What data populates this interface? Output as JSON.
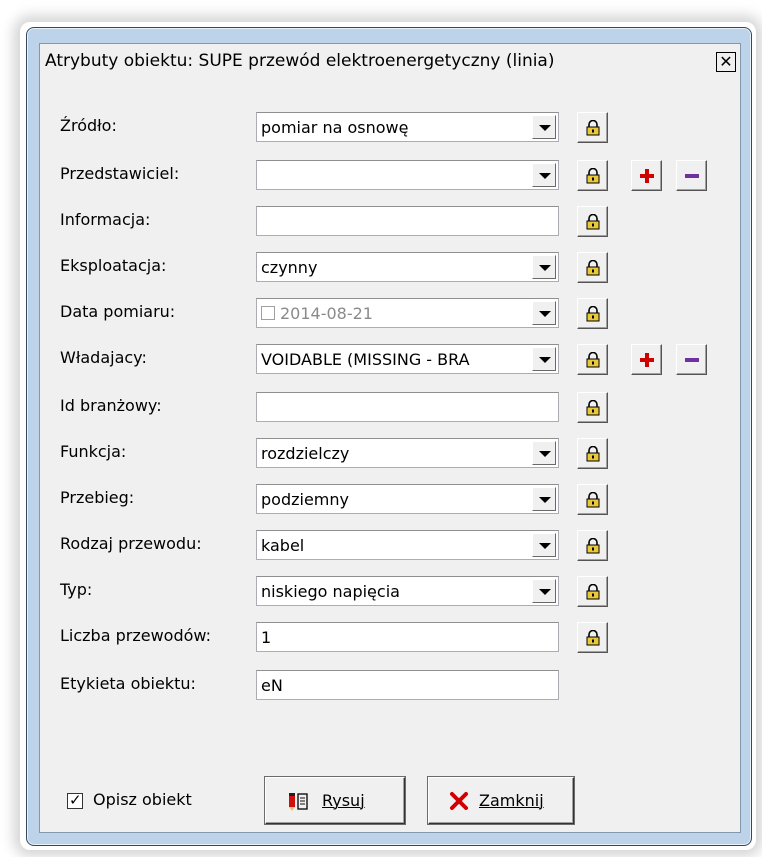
{
  "window": {
    "title": "Atrybuty obiektu: SUPE przewód elektroenergetyczny (linia)"
  },
  "fields": [
    {
      "label": "Źródło:",
      "value": "pomiar na osnowę",
      "kind": "combo",
      "lock": true,
      "plusminus": false
    },
    {
      "label": "Przedstawiciel:",
      "value": "",
      "kind": "combo",
      "lock": true,
      "plusminus": true
    },
    {
      "label": "Informacja:",
      "value": "",
      "kind": "text",
      "lock": true,
      "plusminus": false
    },
    {
      "label": "Eksploatacja:",
      "value": "czynny",
      "kind": "combo",
      "lock": true,
      "plusminus": false
    },
    {
      "label": "Data pomiaru:",
      "value": "2014-08-21",
      "kind": "date",
      "lock": true,
      "plusminus": false
    },
    {
      "label": "Władajacy:",
      "value": "VOIDABLE (MISSING - BRA",
      "kind": "combo",
      "lock": true,
      "plusminus": true
    },
    {
      "label": "Id branżowy:",
      "value": "",
      "kind": "text",
      "lock": true,
      "plusminus": false
    },
    {
      "label": "Funkcja:",
      "value": "rozdzielczy",
      "kind": "combo",
      "lock": true,
      "plusminus": false
    },
    {
      "label": "Przebieg:",
      "value": "podziemny",
      "kind": "combo",
      "lock": true,
      "plusminus": false
    },
    {
      "label": "Rodzaj przewodu:",
      "value": "kabel",
      "kind": "combo",
      "lock": true,
      "plusminus": false
    },
    {
      "label": "Typ:",
      "value": "niskiego napięcia",
      "kind": "combo",
      "lock": true,
      "plusminus": false
    },
    {
      "label": "Liczba przewodów:",
      "value": "1",
      "kind": "text",
      "lock": true,
      "plusminus": false
    },
    {
      "label": "Etykieta obiektu:",
      "value": "eN",
      "kind": "text",
      "lock": false,
      "plusminus": false
    }
  ],
  "footer": {
    "describe_checkbox_label": "Opisz obiekt",
    "describe_checked": true,
    "draw_button_label": "Rysuj",
    "close_button_label": "Zamknij"
  },
  "icons": {
    "lock": "padlock-icon",
    "plus": "plus-icon",
    "minus": "minus-icon",
    "draw": "draw-icon",
    "close": "red-x-icon"
  },
  "colors": {
    "plus_red": "#d00000",
    "minus_purple": "#7030a0",
    "lock_gold": "#c8a000"
  }
}
